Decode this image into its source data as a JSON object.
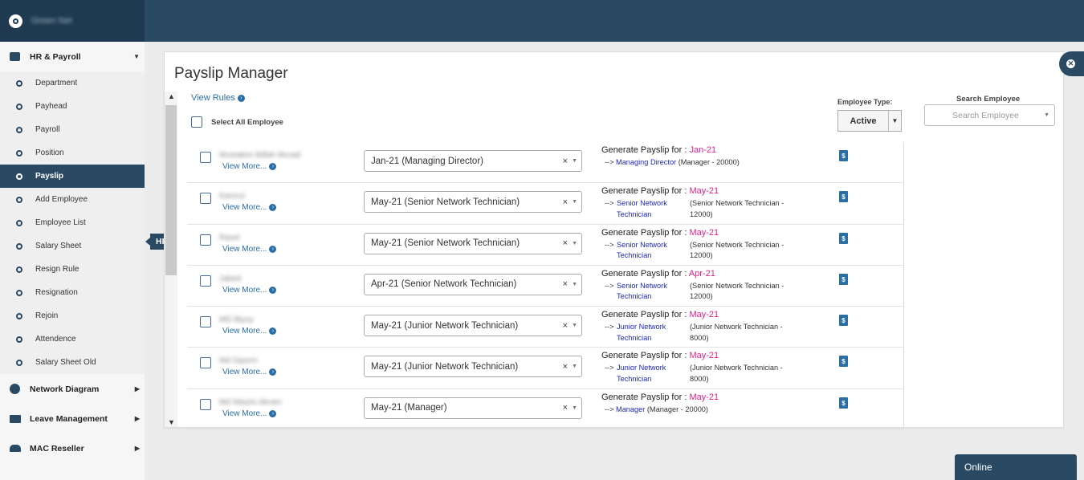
{
  "brand": {
    "name": "Green Net"
  },
  "sidebar": {
    "hr_payroll": {
      "label": "HR & Payroll"
    },
    "items": [
      {
        "label": "Department",
        "active": false
      },
      {
        "label": "Payhead",
        "active": false
      },
      {
        "label": "Payroll",
        "active": false
      },
      {
        "label": "Position",
        "active": false
      },
      {
        "label": "Payslip",
        "active": true
      },
      {
        "label": "Add Employee",
        "active": false
      },
      {
        "label": "Employee List",
        "active": false
      },
      {
        "label": "Salary Sheet",
        "active": false
      },
      {
        "label": "Resign Rule",
        "active": false
      },
      {
        "label": "Resignation",
        "active": false
      },
      {
        "label": "Rejoin",
        "active": false
      },
      {
        "label": "Attendence",
        "active": false
      },
      {
        "label": "Salary Sheet Old",
        "active": false
      }
    ],
    "network_diagram": "Network Diagram",
    "leave_management": "Leave Management",
    "mac_reseller": "MAC Reseller"
  },
  "tooltip": "HR & Payroll",
  "main": {
    "title": "Payslip Manager",
    "view_rules": "View Rules",
    "select_all": "Select All Employee",
    "employee_type_label": "Employee Type:",
    "employee_type_value": "Active",
    "search_label": "Search Employee",
    "search_placeholder": "Search Employee"
  },
  "rows": [
    {
      "name": "Mostakim Billah Murad",
      "view_more": "View More...",
      "selection": "Jan-21 (Managing Director)",
      "gen_label": "Generate Payslip for :",
      "month": "Jan-21",
      "arrow": "-->",
      "position": "Managing Director",
      "detail": "(Manager - 20000)",
      "wrap": false
    },
    {
      "name": "Kamrul",
      "view_more": "View More...",
      "selection": "May-21 (Senior Network Technician)",
      "gen_label": "Generate Payslip for :",
      "month": "May-21",
      "arrow": "-->",
      "position": "Senior Network Technician",
      "detail": "(Senior Network Technician - 12000)",
      "wrap": true
    },
    {
      "name": "Rasel",
      "view_more": "View More...",
      "selection": "May-21 (Senior Network Technician)",
      "gen_label": "Generate Payslip for :",
      "month": "May-21",
      "arrow": "-->",
      "position": "Senior Network Technician",
      "detail": "(Senior Network Technician - 12000)",
      "wrap": true
    },
    {
      "name": "Jabed",
      "view_more": "View More...",
      "selection": "Apr-21 (Senior Network Technician)",
      "gen_label": "Generate Payslip for :",
      "month": "Apr-21",
      "arrow": "-->",
      "position": "Senior Network Technician",
      "detail": "(Senior Network Technician - 12000)",
      "wrap": true
    },
    {
      "name": "MD Biyoy",
      "view_more": "View More...",
      "selection": "May-21 (Junior Network Technician)",
      "gen_label": "Generate Payslip for :",
      "month": "May-21",
      "arrow": "-->",
      "position": "Junior Network Technician",
      "detail": "(Junior Network Technician - 8000)",
      "wrap": true
    },
    {
      "name": "Md Sayem",
      "view_more": "View More...",
      "selection": "May-21 (Junior Network Technician)",
      "gen_label": "Generate Payslip for :",
      "month": "May-21",
      "arrow": "-->",
      "position": "Junior Network Technician",
      "detail": "(Junior Network Technician - 8000)",
      "wrap": true
    },
    {
      "name": "Md Wasim Akram",
      "view_more": "View More...",
      "selection": "May-21 (Manager)",
      "gen_label": "Generate Payslip for :",
      "month": "May-21",
      "arrow": "-->",
      "position": "Manager",
      "detail": "(Manager - 20000)",
      "wrap": false
    }
  ],
  "online": "Online"
}
